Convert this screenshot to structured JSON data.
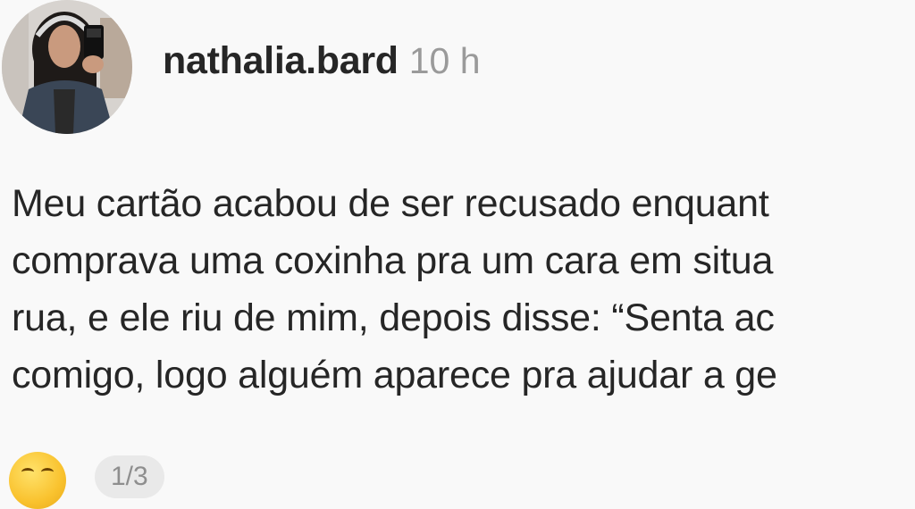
{
  "post": {
    "username": "nathalia.bard",
    "time": "10 h",
    "caption_lines": [
      "Meu cartão acabou de ser recusado enquant",
      "comprava uma coxinha pra um cara em situa",
      "rua, e ele riu de mim, depois disse: “Senta ac",
      "comigo, logo alguém aparece pra ajudar a ge"
    ],
    "emoji_icon": "smiling-face-emoji",
    "page_counter": "1/3"
  },
  "colors": {
    "background": "#f9f9f9",
    "text": "#262626",
    "muted": "#9a9a9a"
  }
}
